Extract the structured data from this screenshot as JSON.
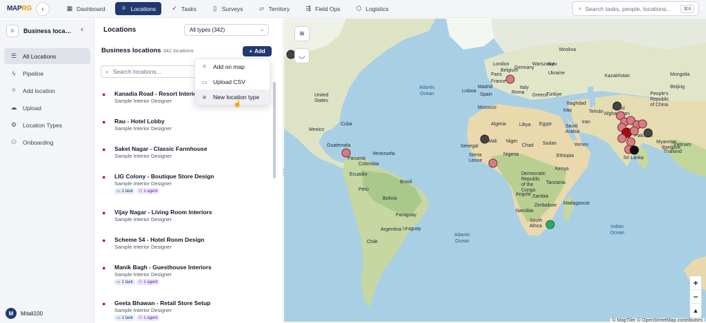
{
  "app": {
    "logo_main": "MAP",
    "logo_accent": "RG"
  },
  "nav": [
    {
      "label": "Dashboard",
      "icon": "grid-icon"
    },
    {
      "label": "Locations",
      "icon": "pin-icon",
      "active": true
    },
    {
      "label": "Tasks",
      "icon": "check-icon"
    },
    {
      "label": "Surveys",
      "icon": "clipboard-icon"
    },
    {
      "label": "Territory",
      "icon": "map-icon"
    },
    {
      "label": "Field Ops",
      "icon": "route-icon"
    },
    {
      "label": "Logistics",
      "icon": "box-icon"
    }
  ],
  "search": {
    "placeholder": "Search tasks, people, locations...",
    "shortcut": "⌘K"
  },
  "sidebar": {
    "workspace": "Business locations",
    "items": [
      {
        "label": "All Locations",
        "active": true
      },
      {
        "label": "Pipeline"
      },
      {
        "label": "Add location"
      },
      {
        "label": "Upload"
      },
      {
        "label": "Location Types"
      },
      {
        "label": "Onboarding"
      }
    ],
    "user": {
      "initial": "M",
      "name": "Mitali100"
    }
  },
  "panel": {
    "title": "Locations",
    "type_filter": "All types (342)",
    "section_title": "Business locations",
    "count": "342 locations",
    "add_label": "Add",
    "search_placeholder": "Search locations...",
    "items": [
      {
        "title": "Kanadia Road - Resort Interiors",
        "subtitle": "Sample Interior Designer",
        "task": "",
        "agent": ""
      },
      {
        "title": "Rau - Hotel Lobby",
        "subtitle": "Sample Interior Designer",
        "task": "",
        "agent": ""
      },
      {
        "title": "Saket Nagar - Classic Farmhouse",
        "subtitle": "Sample Interior Designer",
        "task": "",
        "agent": ""
      },
      {
        "title": "LIG Colony - Boutique Store Design",
        "subtitle": "Sample Interior Designer",
        "task": "1 task",
        "agent": "1 agent"
      },
      {
        "title": "Vijay Nagar - Living Room Interiors",
        "subtitle": "Sample Interior Designer",
        "task": "",
        "agent": ""
      },
      {
        "title": "Scheme 54 - Hotel Room Design",
        "subtitle": "Sample Interior Designer",
        "task": "",
        "agent": ""
      },
      {
        "title": "Manik Bagh - Guesthouse Interiors",
        "subtitle": "Sample Interior Designer",
        "task": "1 task",
        "agent": "1 agent"
      },
      {
        "title": "Geeta Bhawan - Retail Store Setup",
        "subtitle": "Sample Interior Designer",
        "task": "1 task",
        "agent": "1 agent"
      }
    ]
  },
  "add_menu": [
    {
      "label": "Add on map",
      "icon": "pin-icon"
    },
    {
      "label": "Upload CSV",
      "icon": "file-icon"
    },
    {
      "label": "New location type",
      "icon": "layers-icon"
    }
  ],
  "map": {
    "attribution": "© MapTiler © OpenStreetMap contributors",
    "labels": {
      "atlantic1": "Atlantic\nOcean",
      "atlantic2": "Atlantic\nOcean",
      "indian": "Indian\nOcean",
      "kazakhstan": "Kazakhstan",
      "china": "People's\nRepublic\nof China",
      "mongolia": "Mongolia",
      "afghanistan": "Afghanistan",
      "pakistan": "Pakistan",
      "iran": "Iran",
      "turkey": "Türkiye",
      "iraq": "Iraq",
      "saudi": "Saudi\nArabia",
      "yemen": "Yemen",
      "egypt": "Egypt",
      "libya": "Libya",
      "algeria": "Algeria",
      "mali": "Mali",
      "niger": "Niger",
      "chad": "Chad",
      "sudan": "Sudan",
      "ethiopia": "Ethiopia",
      "nigeria": "Nigeria",
      "kenya": "Kenya",
      "tanzania": "Tanzania",
      "drc": "Democratic\nRepublic\nof the\nCongo",
      "angola": "Angola",
      "zambia": "Zambia",
      "zimbabwe": "Zimbabwe",
      "namibia": "Namibia",
      "southafrica": "South\nAfrica",
      "madagascar": "Madagascar",
      "senegal": "Senegal",
      "sierraleone": "Sierra\nLeone",
      "spain": "Spain",
      "france": "France",
      "belgium": "Belgium",
      "germany": "Germany",
      "ukraine": "Ukraine",
      "italy": "Italy",
      "greece": "Greece",
      "morocco": "Morocco",
      "us": "United\nStates",
      "mexico": "Mexico",
      "cuba": "Cuba",
      "guatemala": "Guatemala",
      "panama": "Panamá",
      "venezuela": "Venezuela",
      "colombia": "Colombia",
      "ecuador": "Ecuador",
      "peru": "Perú",
      "brazil": "Brasil",
      "bolivia": "Bolivia",
      "paraguay": "Paraguay",
      "chile": "Chile",
      "argentina": "Argentina",
      "uruguay": "Uruguay",
      "myanmar": "Myanmar",
      "thailand": "Thailand",
      "vietnam": "Vietnam",
      "srilanka": "Sri Lanka",
      "cities": [
        "London",
        "Paris",
        "Warszawa",
        "Roma",
        "Madrid",
        "Lisboa",
        "Kyiv",
        "Moskva",
        "Tehrān",
        "Baghdad",
        "Kābul",
        "Bangkok",
        "Beijing"
      ]
    },
    "colors": {
      "marker_pink": "#d87b84",
      "marker_dark": "#444444",
      "marker_green": "#2bab62",
      "marker_red": "#a10f12",
      "marker_black": "#111111"
    }
  }
}
